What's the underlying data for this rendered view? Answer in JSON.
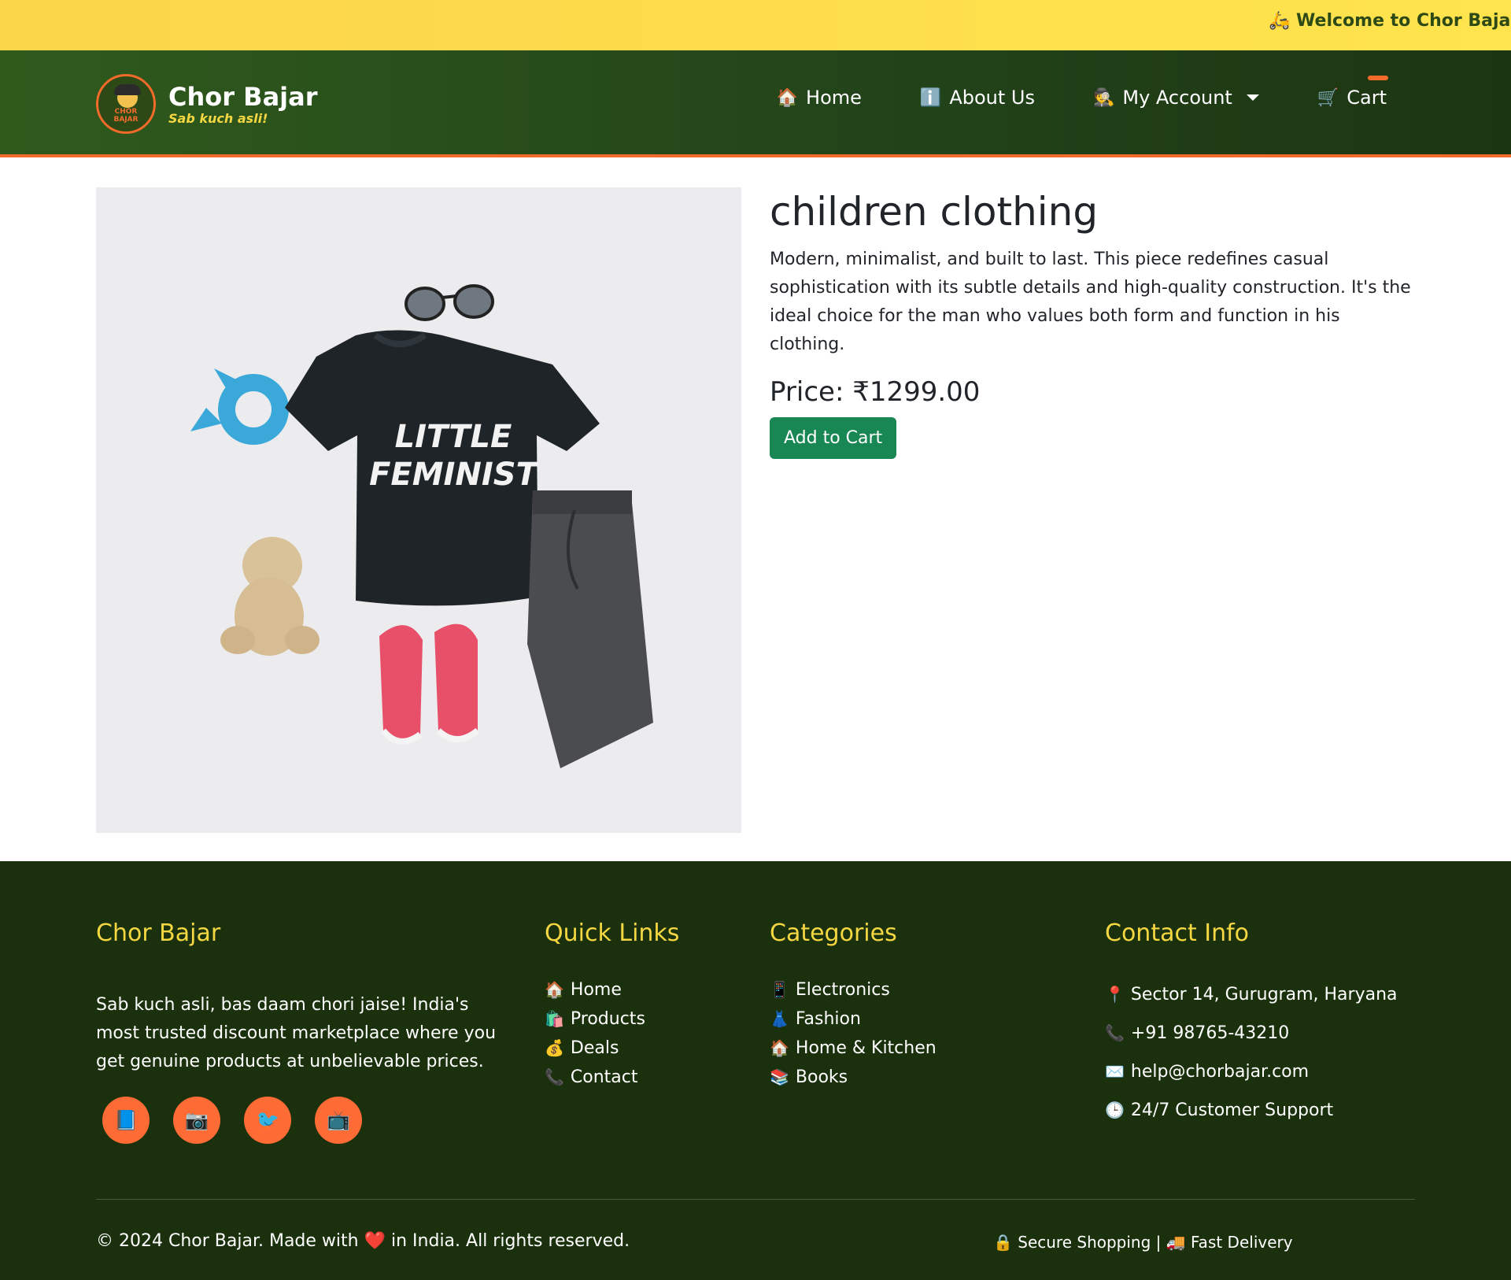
{
  "topbar": {
    "message": "🛵 Welcome to Chor Bajar! | 🔥"
  },
  "brand": {
    "name": "Chor Bajar",
    "tagline": "Sab kuch asli!",
    "logo_line1": "CHOR",
    "logo_line2": "BAJAR"
  },
  "nav": {
    "items": [
      {
        "icon": "🏠",
        "label": "Home"
      },
      {
        "icon": "ℹ️",
        "label": "About Us"
      },
      {
        "icon": "🕵️",
        "label": "My Account"
      },
      {
        "icon": "🛒",
        "label": "Cart"
      }
    ]
  },
  "product": {
    "title": "children clothing",
    "description": "Modern, minimalist, and built to last. This piece redefines casual sophistication with its subtle details and high-quality construction. It's the ideal choice for the man who values both form and function in his clothing.",
    "price": "Price: ₹1299.00",
    "add_to_cart": "Add to Cart",
    "image_shirt_text1": "LITTLE",
    "image_shirt_text2": "FEMINIST"
  },
  "footer": {
    "about": {
      "heading": "Chor Bajar",
      "text": "Sab kuch asli, bas daam chori jaise! India's most trusted discount marketplace where you get genuine products at unbelievable prices."
    },
    "socials": [
      "📘",
      "📷",
      "🐦",
      "📺"
    ],
    "quick_links": {
      "heading": "Quick Links",
      "items": [
        {
          "icon": "🏠",
          "label": "Home"
        },
        {
          "icon": "🛍️",
          "label": "Products"
        },
        {
          "icon": "💰",
          "label": "Deals"
        },
        {
          "icon": "📞",
          "label": "Contact"
        }
      ]
    },
    "categories": {
      "heading": "Categories",
      "items": [
        {
          "icon": "📱",
          "label": "Electronics"
        },
        {
          "icon": "👗",
          "label": "Fashion"
        },
        {
          "icon": "🏠",
          "label": "Home & Kitchen"
        },
        {
          "icon": "📚",
          "label": "Books"
        }
      ]
    },
    "contact": {
      "heading": "Contact Info",
      "items": [
        {
          "icon": "📍",
          "label": "Sector 14, Gurugram, Haryana"
        },
        {
          "icon": "📞",
          "label": "+91 98765-43210"
        },
        {
          "icon": "✉️",
          "label": "help@chorbajar.com"
        },
        {
          "icon": "🕒",
          "label": "24/7 Customer Support"
        }
      ]
    },
    "copyright_pre": "© 2024 Chor Bajar. Made with",
    "heart": "❤️",
    "copyright_post": "in India. All rights reserved.",
    "badges": "🔒 Secure Shopping | 🚚 Fast Delivery"
  },
  "colors": {
    "accent": "#f26b2b",
    "navbar": "#22431a",
    "footer": "#1b310d",
    "heading_gold": "#f5d742",
    "button_green": "#198754"
  }
}
